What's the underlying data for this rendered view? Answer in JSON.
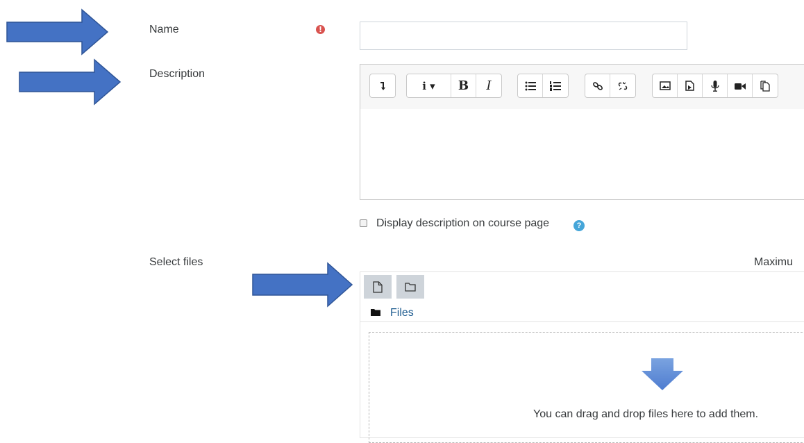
{
  "form": {
    "name_label": "Name",
    "required_icon": "!",
    "name_value": "",
    "description_label": "Description",
    "display_description_label": "Display description on course page",
    "help_icon": "?",
    "select_files_label": "Select files",
    "max_size_text": "Maximu",
    "files_link": "Files",
    "drop_text": "You can drag and drop files here to add them."
  },
  "toolbar": {
    "groups": [
      [
        "expand-icon"
      ],
      [
        "info-dropdown-icon",
        "bold-icon",
        "italic-icon"
      ],
      [
        "unordered-list-icon",
        "ordered-list-icon"
      ],
      [
        "link-icon",
        "unlink-icon"
      ],
      [
        "image-icon",
        "media-icon",
        "record-audio-icon",
        "record-video-icon",
        "manage-files-icon"
      ]
    ],
    "bold": "B",
    "italic": "I",
    "info": "i ▾"
  },
  "colors": {
    "arrow_fill": "#4472c4",
    "arrow_stroke": "#2f5597",
    "required": "#d9534f",
    "help": "#46a6d9",
    "link": "#1d5b8f"
  }
}
